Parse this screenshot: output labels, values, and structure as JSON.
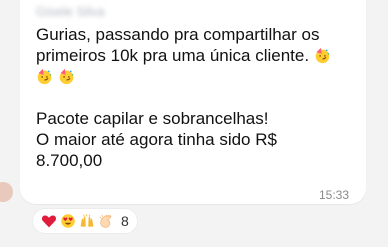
{
  "sender": {
    "name": "Gisele Silva"
  },
  "message": {
    "line1": "Gurias, passando pra compartilhar os",
    "line2": "primeiros 10k pra uma única cliente.",
    "line4": "Pacote capilar e sobrancelhas!",
    "line5": "O maior até agora tinha sido R$",
    "line6": "8.700,00",
    "emojis": [
      "partying-face-emoji",
      "partying-face-emoji",
      "partying-face-emoji"
    ]
  },
  "timestamp": "15:33",
  "reactions": {
    "items": [
      "red-heart",
      "heart-eyes",
      "raising-hands",
      "clapping-hands"
    ],
    "count": "8"
  },
  "colors": {
    "background": "#f3f3f3",
    "bubble": "#ffffff",
    "text": "#111111",
    "timestamp": "#8a8a8a"
  }
}
